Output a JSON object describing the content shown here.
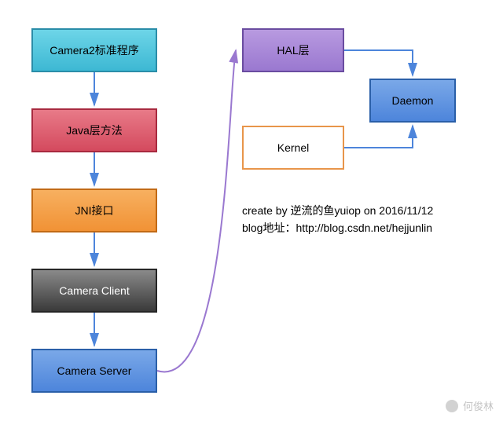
{
  "chart_data": {
    "type": "diagram",
    "title": "",
    "nodes": [
      {
        "id": "camera2",
        "label": "Camera2标准程序",
        "style": "cyan"
      },
      {
        "id": "java",
        "label": "Java层方法",
        "style": "red"
      },
      {
        "id": "jni",
        "label": "JNI接口",
        "style": "orange"
      },
      {
        "id": "client",
        "label": "Camera Client",
        "style": "gray"
      },
      {
        "id": "server",
        "label": "Camera Server",
        "style": "blue"
      },
      {
        "id": "hal",
        "label": "HAL层",
        "style": "purple"
      },
      {
        "id": "daemon",
        "label": "Daemon",
        "style": "blue"
      },
      {
        "id": "kernel",
        "label": "Kernel",
        "style": "white-orange-border"
      }
    ],
    "edges": [
      {
        "from": "camera2",
        "to": "java"
      },
      {
        "from": "java",
        "to": "jni"
      },
      {
        "from": "jni",
        "to": "client"
      },
      {
        "from": "client",
        "to": "server"
      },
      {
        "from": "server",
        "to": "hal"
      },
      {
        "from": "hal",
        "to": "daemon"
      },
      {
        "from": "kernel",
        "to": "daemon"
      }
    ]
  },
  "boxes": {
    "camera2": "Camera2标准程序",
    "java": "Java层方法",
    "jni": "JNI接口",
    "client": "Camera Client",
    "server": "Camera Server",
    "hal": "HAL层",
    "daemon": "Daemon",
    "kernel": "Kernel"
  },
  "credit": {
    "line1": "create by 逆流的鱼yuiop on 2016/11/12",
    "line2": "blog地址：http://blog.csdn.net/hejjunlin"
  },
  "watermark": "何俊林"
}
